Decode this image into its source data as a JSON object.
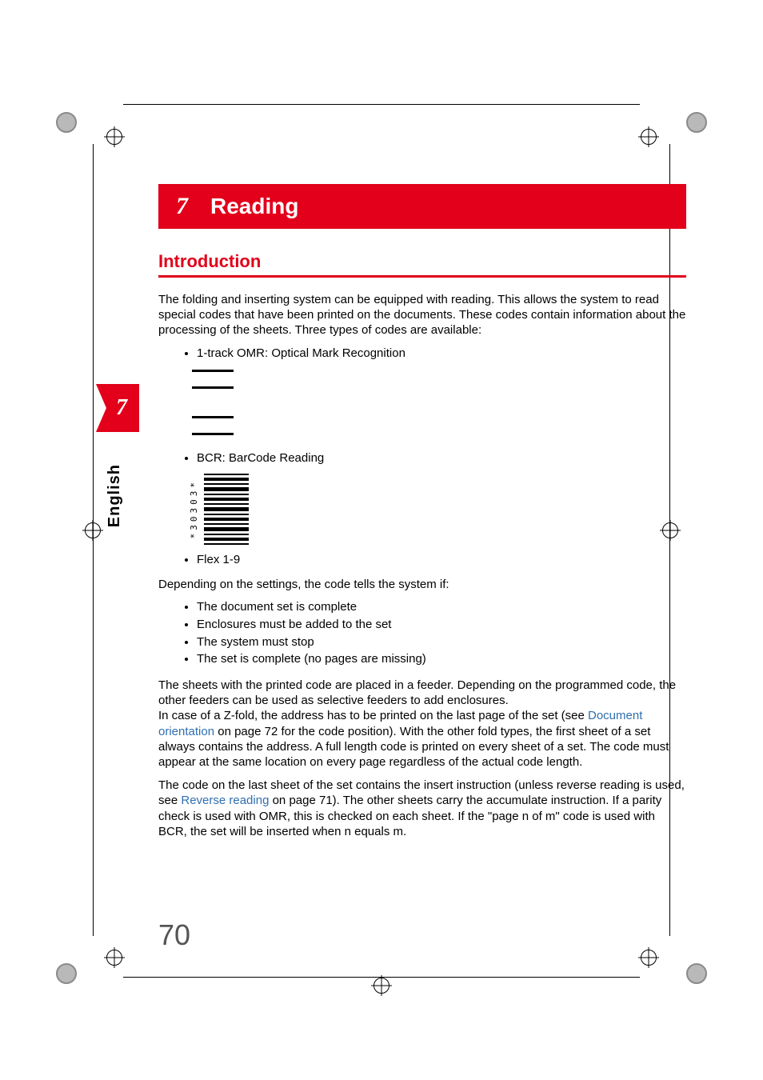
{
  "chapter": {
    "number": "7",
    "title": "Reading"
  },
  "sidetab": {
    "number": "7",
    "language": "English"
  },
  "headings": {
    "intro": "Introduction"
  },
  "intro_para": "The folding and inserting system can be equipped with reading. This allows the system to read special codes that have been printed on the documents. These codes contain information about the processing of the sheets. Three types of codes are available:",
  "code_types": {
    "omr": "1-track OMR: Optical Mark Recognition",
    "bcr": "BCR: BarCode Reading",
    "flex": "Flex 1-9"
  },
  "barcode_label": "*30303*",
  "settings_intro": "Depending on the settings, the code tells the system if:",
  "settings_items": [
    "The document set is complete",
    "Enclosures must be added to the set",
    "The system must stop",
    "The set is complete (no pages are missing)"
  ],
  "para2": {
    "a": "The sheets with the printed code are placed in a feeder. Depending on the programmed code, the other feeders can be used as selective feeders to add enclosures.",
    "b_pre": "In case of a Z-fold, the address has to be printed on the last page of the set (see ",
    "b_link": "Document orientation",
    "b_post": " on page 72 for the code position). With the other fold types, the first sheet of a set always contains the address. A full length code is printed on every sheet of a set. The code must appear at the same location on every page regardless of the actual code length."
  },
  "para3": {
    "a_pre": "The code on the last sheet of the set contains the insert instruction (unless reverse reading is used, see ",
    "a_link": "Reverse reading",
    "a_post": " on page 71). The other sheets carry the accumulate instruction. If a parity check is used with OMR, this is checked on each sheet. If the \"page n of m\" code is used with BCR, the set will be inserted when n equals m."
  },
  "page_number": "70"
}
